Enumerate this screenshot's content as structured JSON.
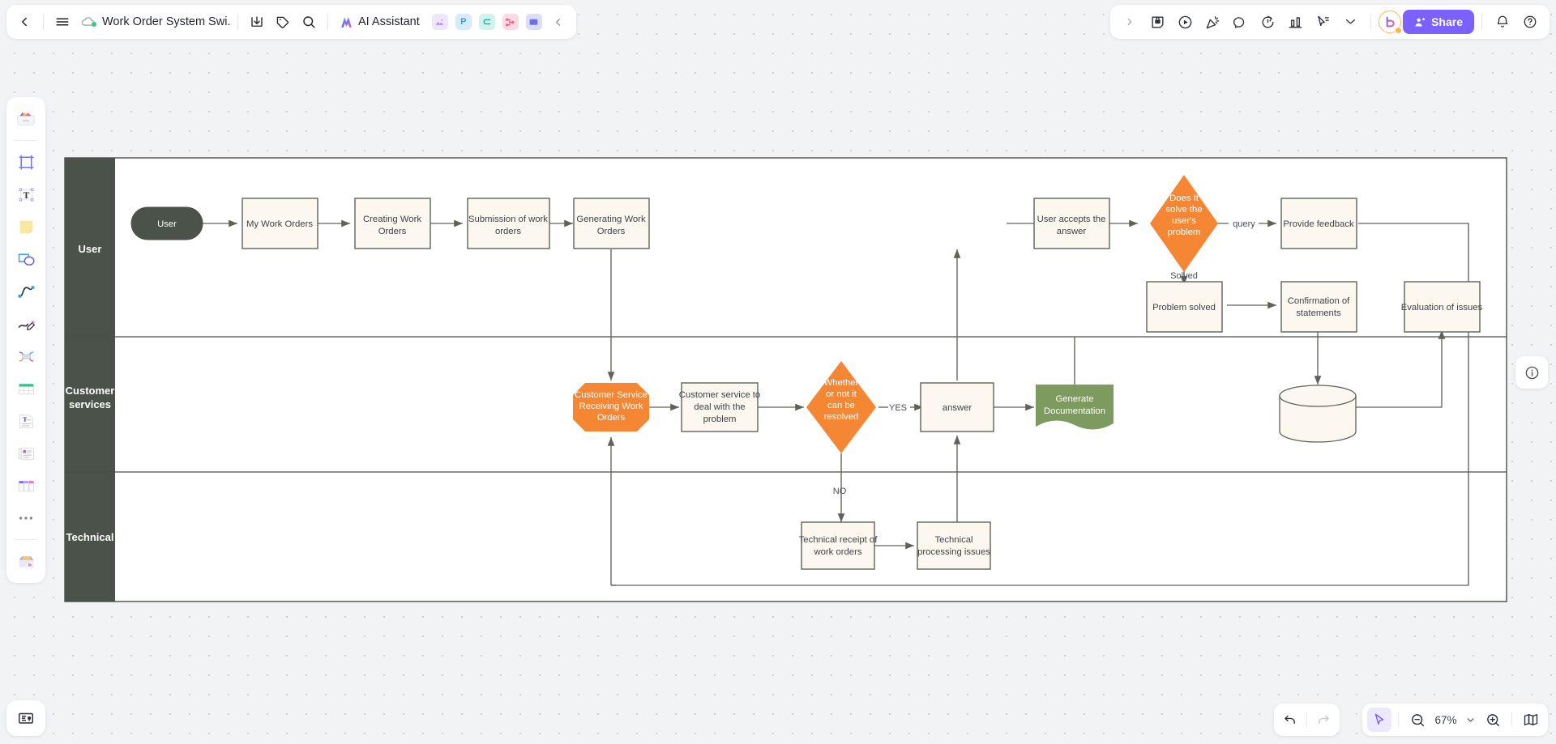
{
  "app": {
    "title": "Work Order System Swi...",
    "ai_assistant_label": "AI Assistant",
    "share_label": "Share",
    "zoom_level": "67%"
  },
  "topbar": {
    "back_tooltip": "Back",
    "menu_tooltip": "Menu",
    "export_tooltip": "Export",
    "tag_tooltip": "Tag",
    "search_tooltip": "Search",
    "collapse_tooltip": "Collapse",
    "mini_apps": [
      {
        "name": "image-app",
        "glyph": "◩",
        "color": "#c9aef5",
        "bg": "#eee6fd"
      },
      {
        "name": "presentation-app",
        "glyph": "P",
        "color": "#4aa8f0",
        "bg": "#d6ecfb"
      },
      {
        "name": "clip-app",
        "glyph": "⊂",
        "color": "#1fb89b",
        "bg": "#d2f3ec"
      },
      {
        "name": "mindmap-app",
        "glyph": "⑂",
        "color": "#f0608e",
        "bg": "#fbdae3"
      },
      {
        "name": "comment-app",
        "glyph": "▤",
        "color": "#6b72e8",
        "bg": "#dcdef9"
      }
    ],
    "right_icons": [
      {
        "name": "chevron-right-icon"
      },
      {
        "name": "sticky-lock-icon"
      },
      {
        "name": "play-circle-icon"
      },
      {
        "name": "confetti-icon"
      },
      {
        "name": "comment-bubble-icon"
      },
      {
        "name": "timer-icon"
      },
      {
        "name": "chart-icon"
      },
      {
        "name": "cursor-pointer-icon"
      },
      {
        "name": "chevron-double-down-icon"
      }
    ],
    "notification_tooltip": "Notifications",
    "help_tooltip": "Help"
  },
  "left_rail": [
    {
      "name": "templates-tool",
      "label": "Templates"
    },
    {
      "name": "frame-tool",
      "label": "Frame"
    },
    {
      "name": "text-tool",
      "label": "Text"
    },
    {
      "name": "sticky-note-tool",
      "label": "Sticky note"
    },
    {
      "name": "shapes-tool",
      "label": "Shapes"
    },
    {
      "name": "connector-tool",
      "label": "Connector"
    },
    {
      "name": "pen-tool",
      "label": "Pen"
    },
    {
      "name": "mindmap-tool",
      "label": "Mind map"
    },
    {
      "name": "table-tool",
      "label": "Table"
    },
    {
      "name": "document-tool",
      "label": "Document"
    },
    {
      "name": "cards-tool",
      "label": "Cards"
    },
    {
      "name": "kanban-tool",
      "label": "Kanban"
    },
    {
      "name": "more-tools",
      "label": "More"
    },
    {
      "name": "assets-tool",
      "label": "Assets"
    }
  ],
  "bottom": {
    "undo_label": "Undo",
    "redo_label": "Redo",
    "select_tool_label": "Select",
    "zoom_out_label": "Zoom out",
    "zoom_in_label": "Zoom in",
    "minimap_label": "Minimap",
    "notes_label": "Notes"
  },
  "diagram": {
    "title": "Work Order System Swimlane Flowchart",
    "lanes": [
      {
        "name": "lane-user",
        "label": "User"
      },
      {
        "name": "lane-customer-services",
        "label": "Customer services"
      },
      {
        "name": "lane-technical",
        "label": "Technical"
      }
    ],
    "nodes": [
      {
        "id": "user",
        "label": "User",
        "shape": "rounded",
        "fill": "#4a5249",
        "text": "#ffffff"
      },
      {
        "id": "my-work-orders",
        "label": "My Work Orders",
        "shape": "rect",
        "fill": "#fcf8ef",
        "text": "#3e4248"
      },
      {
        "id": "creating-work-orders",
        "label": "Creating Work Orders",
        "shape": "rect",
        "fill": "#fcf8ef",
        "text": "#3e4248"
      },
      {
        "id": "submission-of-work-orders",
        "label": "Submission of work orders",
        "shape": "rect",
        "fill": "#fcf8ef",
        "text": "#3e4248"
      },
      {
        "id": "generating-work-orders",
        "label": "Generating Work Orders",
        "shape": "rect",
        "fill": "#fcf8ef",
        "text": "#3e4248"
      },
      {
        "id": "user-accepts-the-answer",
        "label": "User accepts the answer",
        "shape": "rect",
        "fill": "#fcf8ef",
        "text": "#3e4248"
      },
      {
        "id": "does-it-solve",
        "label": "Does It solve the user's problem",
        "shape": "diamond",
        "fill": "#f58634",
        "text": "#ffffff"
      },
      {
        "id": "provide-feedback",
        "label": "Provide feedback",
        "shape": "rect",
        "fill": "#fcf8ef",
        "text": "#3e4248"
      },
      {
        "id": "problem-solved",
        "label": "Problem solved",
        "shape": "rect",
        "fill": "#fcf8ef",
        "text": "#3e4248"
      },
      {
        "id": "confirmation-of-statements",
        "label": "Confirmation of statements",
        "shape": "rect",
        "fill": "#fcf8ef",
        "text": "#3e4248"
      },
      {
        "id": "evaluation-of-issues",
        "label": "Evaluation of issues",
        "shape": "rect",
        "fill": "#fcf8ef",
        "text": "#3e4248"
      },
      {
        "id": "cs-receiving-work-orders",
        "label": "Customer Service Receiving Work Orders",
        "shape": "octagon",
        "fill": "#f58634",
        "text": "#ffffff"
      },
      {
        "id": "cs-deal-with-problem",
        "label": "Customer service to deal with the problem",
        "shape": "rect",
        "fill": "#fcf8ef",
        "text": "#3e4248"
      },
      {
        "id": "whether-can-be-resolved",
        "label": "Whether or not it can be resolved",
        "shape": "diamond",
        "fill": "#f58634",
        "text": "#ffffff"
      },
      {
        "id": "answer",
        "label": "answer",
        "shape": "rect",
        "fill": "#fcf8ef",
        "text": "#3e4248"
      },
      {
        "id": "generate-documentation",
        "label": "Generate Documentation",
        "shape": "document",
        "fill": "#7d9b5e",
        "text": "#ffffff"
      },
      {
        "id": "database",
        "label": "",
        "shape": "cylinder",
        "fill": "#fcf8ef",
        "text": "#3e4248"
      },
      {
        "id": "technical-receipt",
        "label": "Technical receipt of work orders",
        "shape": "rect",
        "fill": "#fcf8ef",
        "text": "#3e4248"
      },
      {
        "id": "technical-processing",
        "label": "Technical processing issues",
        "shape": "rect",
        "fill": "#fcf8ef",
        "text": "#3e4248"
      }
    ],
    "edge_labels": [
      {
        "id": "edge-query",
        "label": "query"
      },
      {
        "id": "edge-solved",
        "label": "Solved"
      },
      {
        "id": "edge-yes",
        "label": "YES"
      },
      {
        "id": "edge-no",
        "label": "NO"
      }
    ],
    "colors": {
      "lane_header": "#4a5249",
      "node_fill": "#fcf8ef",
      "node_stroke": "#5d6359",
      "decision_fill": "#f58634",
      "document_fill": "#7d9b5e",
      "edge_stroke": "#5d6359"
    }
  }
}
